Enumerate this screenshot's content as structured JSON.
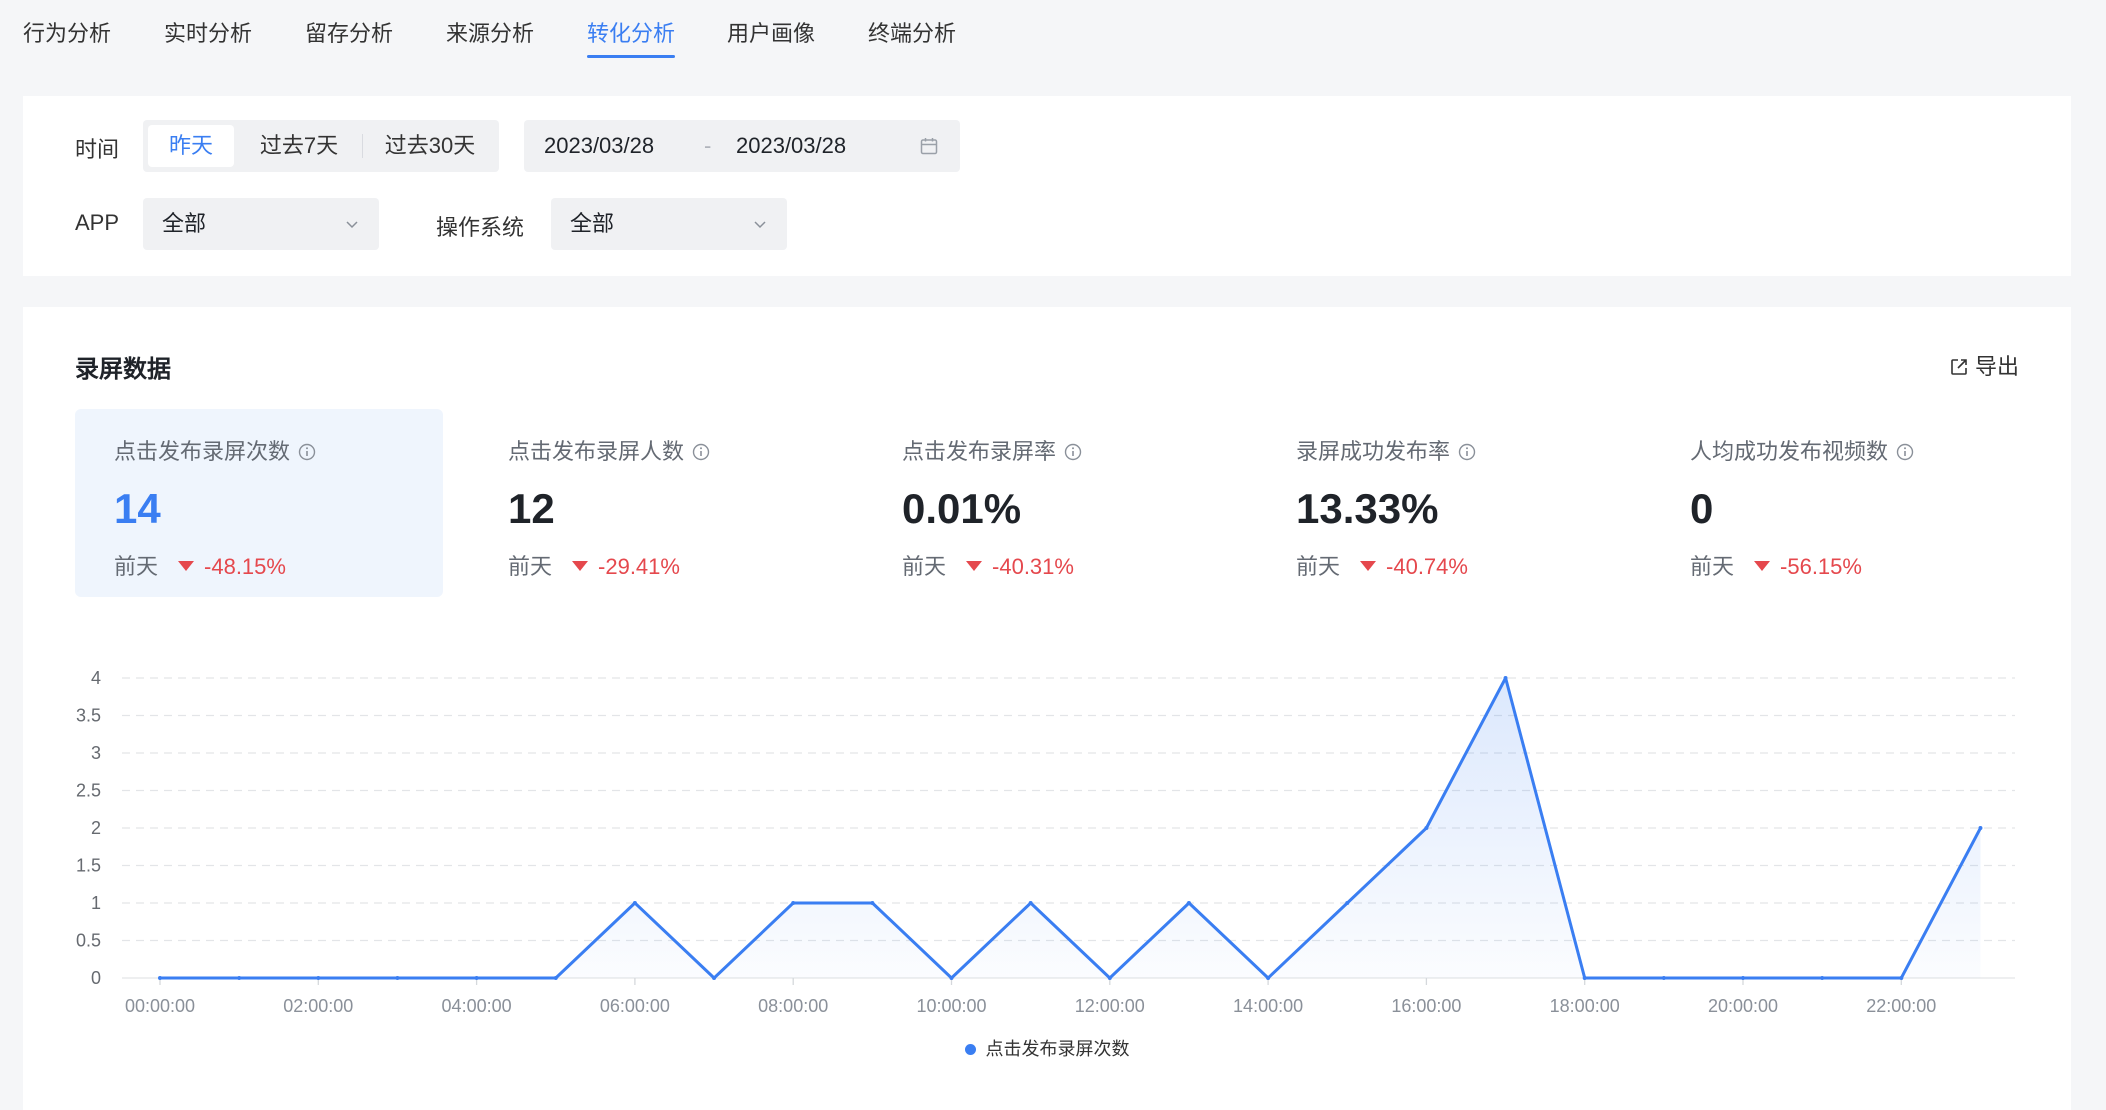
{
  "tabs": [
    {
      "label": "行为分析",
      "active": false
    },
    {
      "label": "实时分析",
      "active": false
    },
    {
      "label": "留存分析",
      "active": false
    },
    {
      "label": "来源分析",
      "active": false
    },
    {
      "label": "转化分析",
      "active": true
    },
    {
      "label": "用户画像",
      "active": false
    },
    {
      "label": "终端分析",
      "active": false
    }
  ],
  "filters": {
    "time_label": "时间",
    "time_options": [
      "昨天",
      "过去7天",
      "过去30天"
    ],
    "time_selected": "昨天",
    "date_start": "2023/03/28",
    "date_sep": "-",
    "date_end": "2023/03/28",
    "app_label": "APP",
    "app_value": "全部",
    "os_label": "操作系统",
    "os_value": "全部"
  },
  "panel": {
    "title": "录屏数据",
    "export_label": "导出"
  },
  "metrics": [
    {
      "label": "点击发布录屏次数",
      "value": "14",
      "compare_label": "前天",
      "change": "-48.15%",
      "active": true
    },
    {
      "label": "点击发布录屏人数",
      "value": "12",
      "compare_label": "前天",
      "change": "-29.41%",
      "active": false
    },
    {
      "label": "点击发布录屏率",
      "value": "0.01%",
      "compare_label": "前天",
      "change": "-40.31%",
      "active": false
    },
    {
      "label": "录屏成功发布率",
      "value": "13.33%",
      "compare_label": "前天",
      "change": "-40.74%",
      "active": false
    },
    {
      "label": "人均成功发布视频数",
      "value": "0",
      "compare_label": "前天",
      "change": "-56.15%",
      "active": false
    }
  ],
  "colors": {
    "accent": "#3a7ef2",
    "down": "#e5484d"
  },
  "chart_data": {
    "type": "area",
    "x": [
      "00:00:00",
      "01:00:00",
      "02:00:00",
      "03:00:00",
      "04:00:00",
      "05:00:00",
      "06:00:00",
      "07:00:00",
      "08:00:00",
      "09:00:00",
      "10:00:00",
      "11:00:00",
      "12:00:00",
      "13:00:00",
      "14:00:00",
      "15:00:00",
      "16:00:00",
      "17:00:00",
      "18:00:00",
      "19:00:00",
      "20:00:00",
      "21:00:00",
      "22:00:00",
      "23:00:00"
    ],
    "x_tick_labels": [
      "00:00:00",
      "02:00:00",
      "04:00:00",
      "06:00:00",
      "08:00:00",
      "10:00:00",
      "12:00:00",
      "14:00:00",
      "16:00:00",
      "18:00:00",
      "20:00:00",
      "22:00:00"
    ],
    "series": [
      {
        "name": "点击发布录屏次数",
        "values": [
          0,
          0,
          0,
          0,
          0,
          0,
          1,
          0,
          1,
          1,
          0,
          1,
          0,
          1,
          0,
          1,
          2,
          4,
          0,
          0,
          0,
          0,
          0,
          2
        ]
      }
    ],
    "y_ticks": [
      "0",
      "0.5",
      "1",
      "1.5",
      "2",
      "2.5",
      "3",
      "3.5",
      "4"
    ],
    "ylim": [
      0,
      4
    ],
    "grid": true,
    "legend": "bottom-center"
  }
}
